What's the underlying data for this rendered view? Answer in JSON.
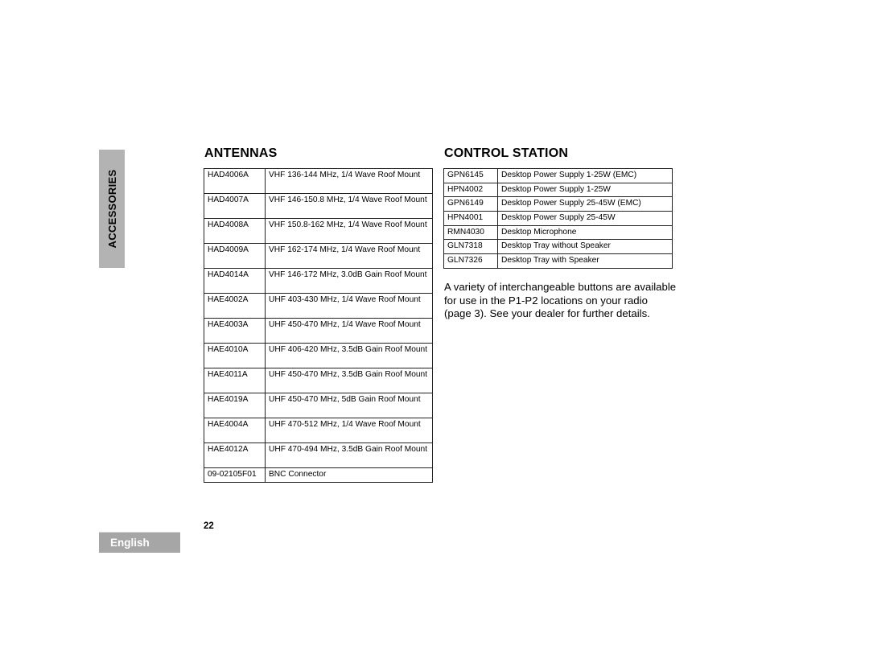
{
  "side_tab": {
    "label": "ACCESSORIES"
  },
  "language_tab": {
    "label": "English"
  },
  "page_number": "22",
  "antennas": {
    "heading": "ANTENNAS",
    "rows": [
      {
        "code": "HAD4006A",
        "description": "VHF 136-144 MHz, 1/4 Wave Roof Mount"
      },
      {
        "code": "HAD4007A",
        "description": "VHF 146-150.8 MHz, 1/4 Wave Roof Mount"
      },
      {
        "code": "HAD4008A",
        "description": "VHF 150.8-162 MHz, 1/4 Wave Roof Mount"
      },
      {
        "code": "HAD4009A",
        "description": "VHF 162-174 MHz, 1/4 Wave Roof Mount"
      },
      {
        "code": "HAD4014A",
        "description": "VHF 146-172 MHz, 3.0dB Gain Roof Mount"
      },
      {
        "code": "HAE4002A",
        "description": "UHF 403-430 MHz, 1/4 Wave Roof Mount"
      },
      {
        "code": "HAE4003A",
        "description": "UHF 450-470 MHz, 1/4 Wave Roof Mount"
      },
      {
        "code": "HAE4010A",
        "description": "UHF 406-420 MHz, 3.5dB Gain Roof Mount"
      },
      {
        "code": "HAE4011A",
        "description": "UHF 450-470 MHz, 3.5dB Gain Roof Mount"
      },
      {
        "code": "HAE4019A",
        "description": "UHF 450-470 MHz, 5dB Gain Roof Mount"
      },
      {
        "code": "HAE4004A",
        "description": "UHF 470-512 MHz, 1/4 Wave Roof Mount"
      },
      {
        "code": "HAE4012A",
        "description": "UHF 470-494 MHz, 3.5dB Gain Roof Mount"
      },
      {
        "code": "09-02105F01",
        "description": "BNC Connector"
      }
    ]
  },
  "control_station": {
    "heading": "CONTROL STATION",
    "rows": [
      {
        "code": "GPN6145",
        "description": "Desktop Power Supply 1-25W (EMC)"
      },
      {
        "code": "HPN4002",
        "description": "Desktop Power Supply 1-25W"
      },
      {
        "code": "GPN6149",
        "description": "Desktop Power Supply 25-45W (EMC)"
      },
      {
        "code": "HPN4001",
        "description": "Desktop Power Supply 25-45W"
      },
      {
        "code": "RMN4030",
        "description": "Desktop Microphone"
      },
      {
        "code": "GLN7318",
        "description": "Desktop Tray without Speaker"
      },
      {
        "code": "GLN7326",
        "description": "Desktop Tray with Speaker"
      }
    ],
    "note": "A variety of interchangeable buttons are available for use in the P1-P2 locations on your radio (page 3). See your dealer for further details."
  }
}
